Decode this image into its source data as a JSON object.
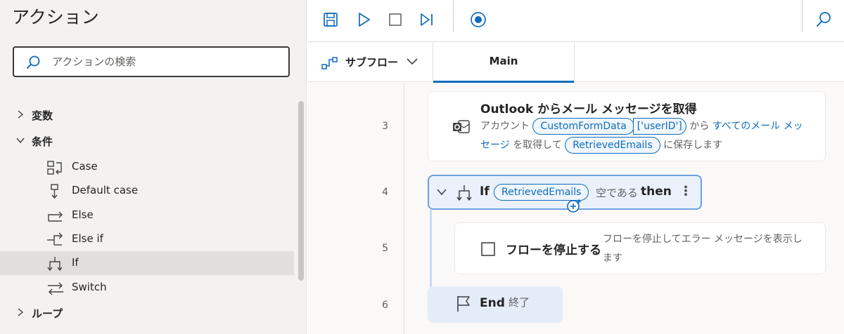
{
  "actions_pane": {
    "title": "アクション",
    "search_placeholder": "アクションの検索",
    "tree": [
      {
        "label": "変数",
        "type": "category",
        "expanded": false
      },
      {
        "label": "条件",
        "type": "category",
        "expanded": true
      },
      {
        "label": "Case",
        "type": "leaf",
        "icon": "case-icon"
      },
      {
        "label": "Default case",
        "type": "leaf",
        "icon": "default-case-icon"
      },
      {
        "label": "Else",
        "type": "leaf",
        "icon": "else-icon"
      },
      {
        "label": "Else if",
        "type": "leaf",
        "icon": "else-if-icon"
      },
      {
        "label": "If",
        "type": "leaf",
        "icon": "if-icon",
        "selected": true
      },
      {
        "label": "Switch",
        "type": "leaf",
        "icon": "switch-icon"
      },
      {
        "label": "ループ",
        "type": "category",
        "expanded": false
      }
    ]
  },
  "toolbar": {
    "icons": [
      "save-icon",
      "run-icon",
      "stop-icon",
      "run-next-action-icon",
      "record-icon",
      "search-icon"
    ]
  },
  "tabs": {
    "subflow_label": "サブフロー",
    "main_label": "Main"
  },
  "flow": {
    "actions": [
      {
        "line": "3",
        "title": "Outlook からメール メッセージを取得",
        "desc": {
          "p1": "アカウント",
          "token1": "CustomFormData",
          "token1_suffix": "['userID']",
          "p2": "から",
          "link1": "すべてのメール メッセージ",
          "p3": "を取得して",
          "token2": "RetrievedEmails",
          "p4": "に保存します"
        }
      },
      {
        "line": "4",
        "keyword": "If",
        "token": "RetrievedEmails",
        "condition": "空である",
        "then": "then"
      },
      {
        "line": "5",
        "title": "フローを停止する",
        "desc": "フローを停止してエラー メッセージを表示します"
      },
      {
        "line": "6",
        "keyword": "End",
        "label": "終了"
      }
    ]
  },
  "colors": {
    "accent": "#0f6cbd",
    "pane_bg": "#f3f2f1",
    "selected_block": "#eaf1fb"
  }
}
